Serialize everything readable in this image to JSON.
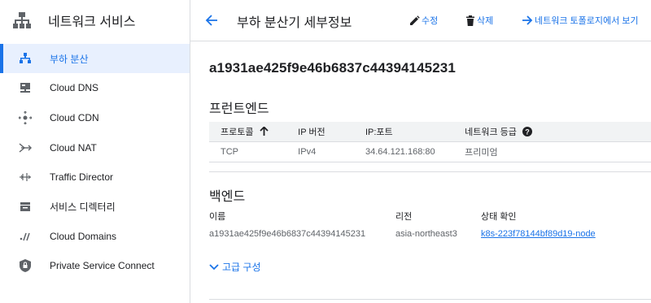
{
  "sidebar": {
    "title": "네트워크 서비스",
    "items": [
      {
        "label": "부하 분산",
        "icon": "load-balancing-icon"
      },
      {
        "label": "Cloud DNS",
        "icon": "dns-icon"
      },
      {
        "label": "Cloud CDN",
        "icon": "cdn-icon"
      },
      {
        "label": "Cloud NAT",
        "icon": "nat-icon"
      },
      {
        "label": "Traffic Director",
        "icon": "traffic-director-icon"
      },
      {
        "label": "서비스 디렉터리",
        "icon": "service-directory-icon"
      },
      {
        "label": "Cloud Domains",
        "icon": "domains-icon"
      },
      {
        "label": "Private Service Connect",
        "icon": "private-service-connect-icon"
      }
    ]
  },
  "topbar": {
    "title": "부하 분산기 세부정보",
    "edit_label": "수정",
    "delete_label": "삭제",
    "topology_label": "네트워크 토폴로지에서 보기"
  },
  "load_balancer": {
    "id": "a1931ae425f9e46b6837c44394145231"
  },
  "frontend": {
    "title": "프런트엔드",
    "headers": [
      "프로토콜",
      "IP 버전",
      "IP:포트",
      "네트워크 등급"
    ],
    "rows": [
      [
        "TCP",
        "IPv4",
        "34.64.121.168:80",
        "프리미엄"
      ]
    ]
  },
  "backend": {
    "title": "백엔드",
    "headers": [
      "이름",
      "리전",
      "상태 확인"
    ],
    "rows": [
      [
        "a1931ae425f9e46b6837c44394145231",
        "asia-northeast3",
        "k8s-223f78144bf89d19-node"
      ]
    ]
  },
  "advanced_label": "고급 구성",
  "colors": {
    "accent": "#1a73e8",
    "active_bg": "#e8f0fe",
    "header_bg": "#f1f3f4",
    "text": "#202124",
    "muted": "#5f6368"
  }
}
